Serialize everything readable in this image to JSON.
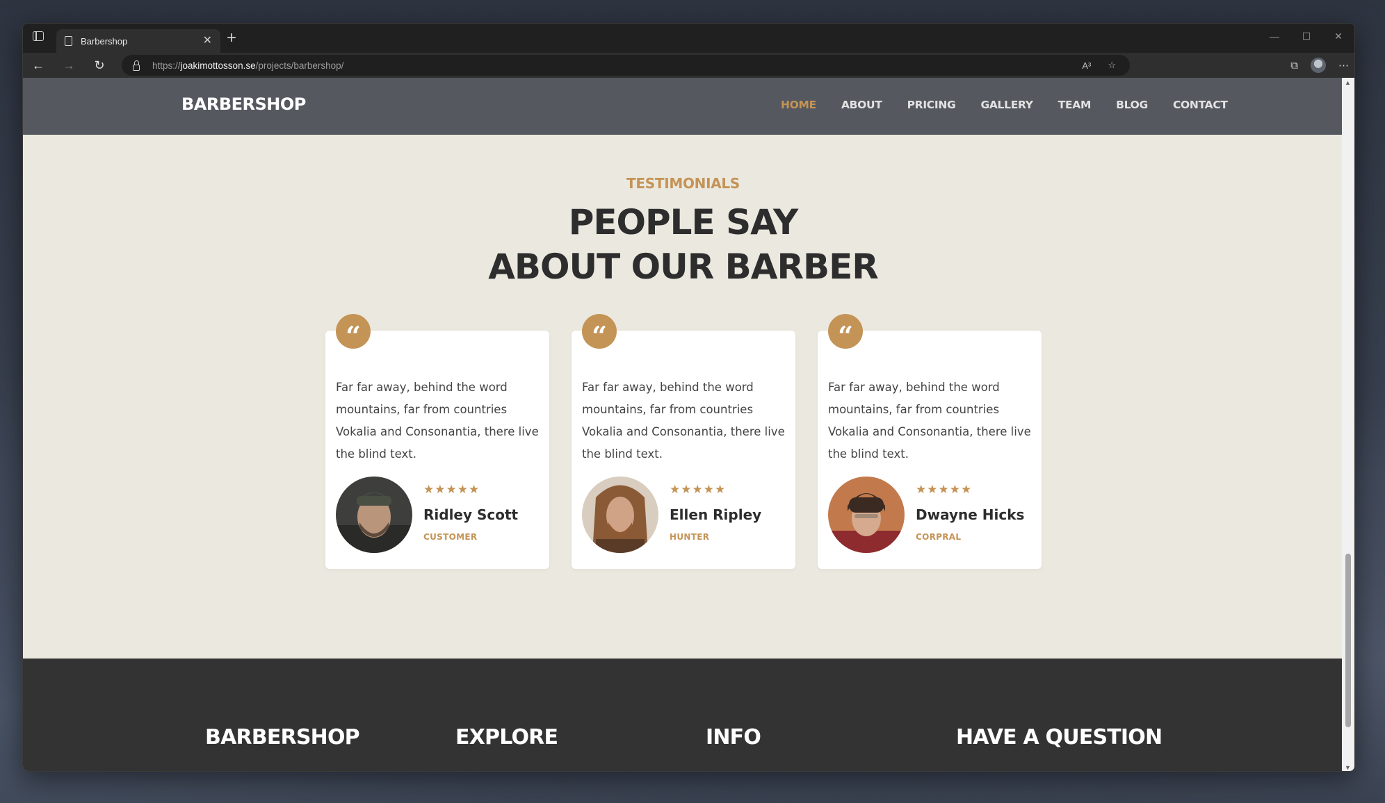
{
  "browser": {
    "tab_title": "Barbershop",
    "tab_close": "✕",
    "new_tab": "+",
    "url_scheme": "https://",
    "url_host": "joakimottosson.se",
    "url_path": "/projects/barbershop/",
    "url_read_aloud": "A³"
  },
  "header": {
    "brand": "BARBERSHOP",
    "nav": [
      "HOME",
      "ABOUT",
      "PRICING",
      "GALLERY",
      "TEAM",
      "BLOG",
      "CONTACT"
    ],
    "active": "HOME"
  },
  "testimonials": {
    "eyebrow": "TESTIMONIALS",
    "heading_line1": "PEOPLE SAY",
    "heading_line2": "ABOUT OUR BARBER",
    "quote_mark": "“",
    "items": [
      {
        "text": "Far far away, behind the word mountains, far from countries Vokalia and Consonantia, there live the blind text.",
        "stars": "★★★★★",
        "rating": 5,
        "name": "Ridley Scott",
        "role": "CUSTOMER"
      },
      {
        "text": "Far far away, behind the word mountains, far from countries Vokalia and Consonantia, there live the blind text.",
        "stars": "★★★★★",
        "rating": 5,
        "name": "Ellen Ripley",
        "role": "HUNTER"
      },
      {
        "text": "Far far away, behind the word mountains, far from countries Vokalia and Consonantia, there live the blind text.",
        "stars": "★★★★★",
        "rating": 5,
        "name": "Dwayne Hicks",
        "role": "CORPRAL"
      }
    ]
  },
  "footer": {
    "columns": [
      "BARBERSHOP",
      "EXPLORE",
      "INFO",
      "HAVE A QUESTION"
    ]
  },
  "colors": {
    "accent": "#c49456",
    "header_bg": "#55595f",
    "page_bg": "#ebe8df",
    "footer_bg": "#333333"
  }
}
